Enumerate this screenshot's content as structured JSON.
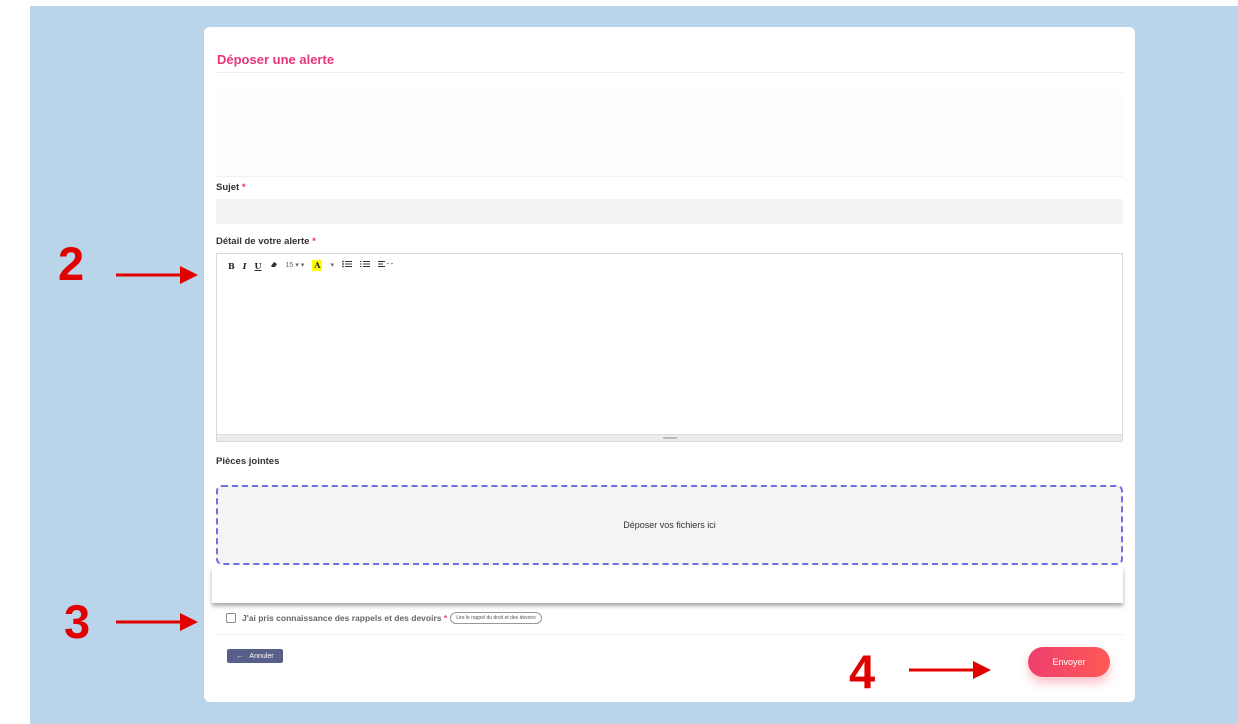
{
  "form": {
    "title": "Déposer une alerte",
    "sujet_label": "Sujet",
    "required_mark": "*",
    "detail_label": "Détail de votre alerte",
    "attachments_label": "Pièces jointes",
    "dropzone_text": "Déposer vos fichiers ici",
    "checkbox_label": "J'ai pris connaissance des rappels et des devoirs",
    "rights_link": "Lire le rappel du droit et des devoirs",
    "cancel_label": "Annuler",
    "submit_label": "Envoyer"
  },
  "editor_toolbar": {
    "bold": "B",
    "italic": "I",
    "underline": "U",
    "font_size": "15",
    "highlight": "A"
  },
  "annotations": [
    "2",
    "3",
    "4"
  ],
  "colors": {
    "background": "#bad4ea",
    "accent": "#e8357a",
    "annotation": "#e10000",
    "cancel_button": "#585f8a",
    "dropzone_border": "#6f6fe0"
  }
}
